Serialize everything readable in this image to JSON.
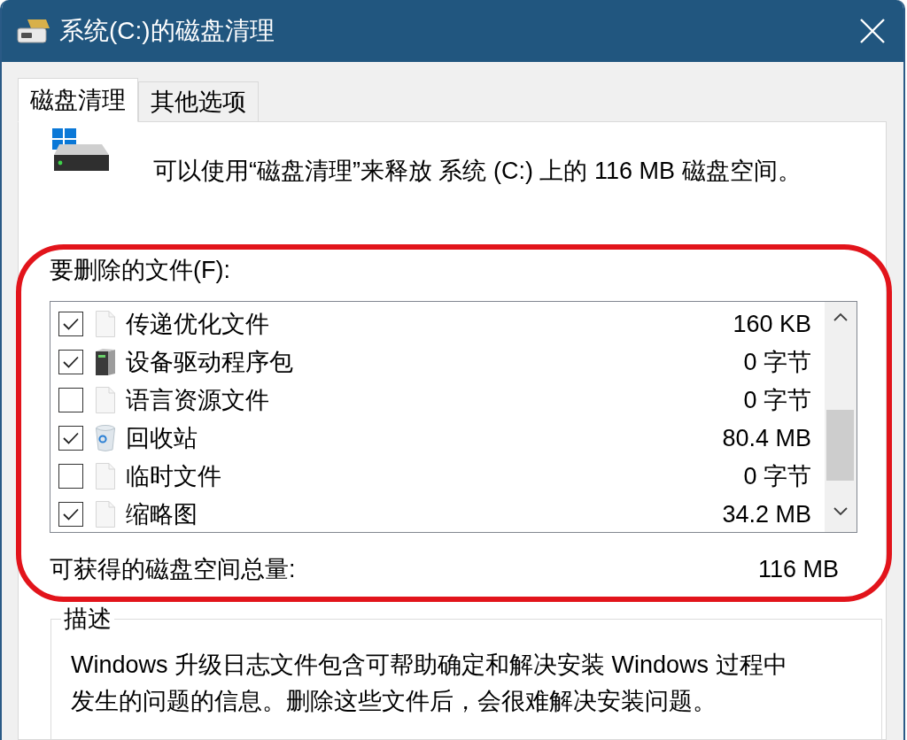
{
  "window": {
    "title": "系统(C:)的磁盘清理"
  },
  "tabs": [
    {
      "label": "磁盘清理",
      "selected": true
    },
    {
      "label": "其他选项",
      "selected": false
    }
  ],
  "summary": {
    "text": "可以使用“磁盘清理”来释放 系统 (C:) 上的 116 MB 磁盘空间。"
  },
  "files": {
    "label": "要删除的文件(F):",
    "highlighted": true,
    "items": [
      {
        "kind": "file",
        "name": "传递优化文件",
        "size": "160 KB",
        "checked": true
      },
      {
        "kind": "device",
        "name": "设备驱动程序包",
        "size": "0 字节",
        "checked": true
      },
      {
        "kind": "file",
        "name": "语言资源文件",
        "size": "0 字节",
        "checked": false
      },
      {
        "kind": "recycle_bin",
        "name": "回收站",
        "size": "80.4 MB",
        "checked": true
      },
      {
        "kind": "file",
        "name": "临时文件",
        "size": "0 字节",
        "checked": false
      },
      {
        "kind": "file",
        "name": "缩略图",
        "size": "34.2 MB",
        "checked": true
      }
    ]
  },
  "total": {
    "label": "可获得的磁盘空间总量:",
    "value": "116 MB"
  },
  "description": {
    "title": "描述",
    "lines": [
      "Windows 升级日志文件包含可帮助确定和解决安装 Windows 过程中",
      "发生的问题的信息。删除这些文件后，会很难解决安装问题。"
    ]
  }
}
